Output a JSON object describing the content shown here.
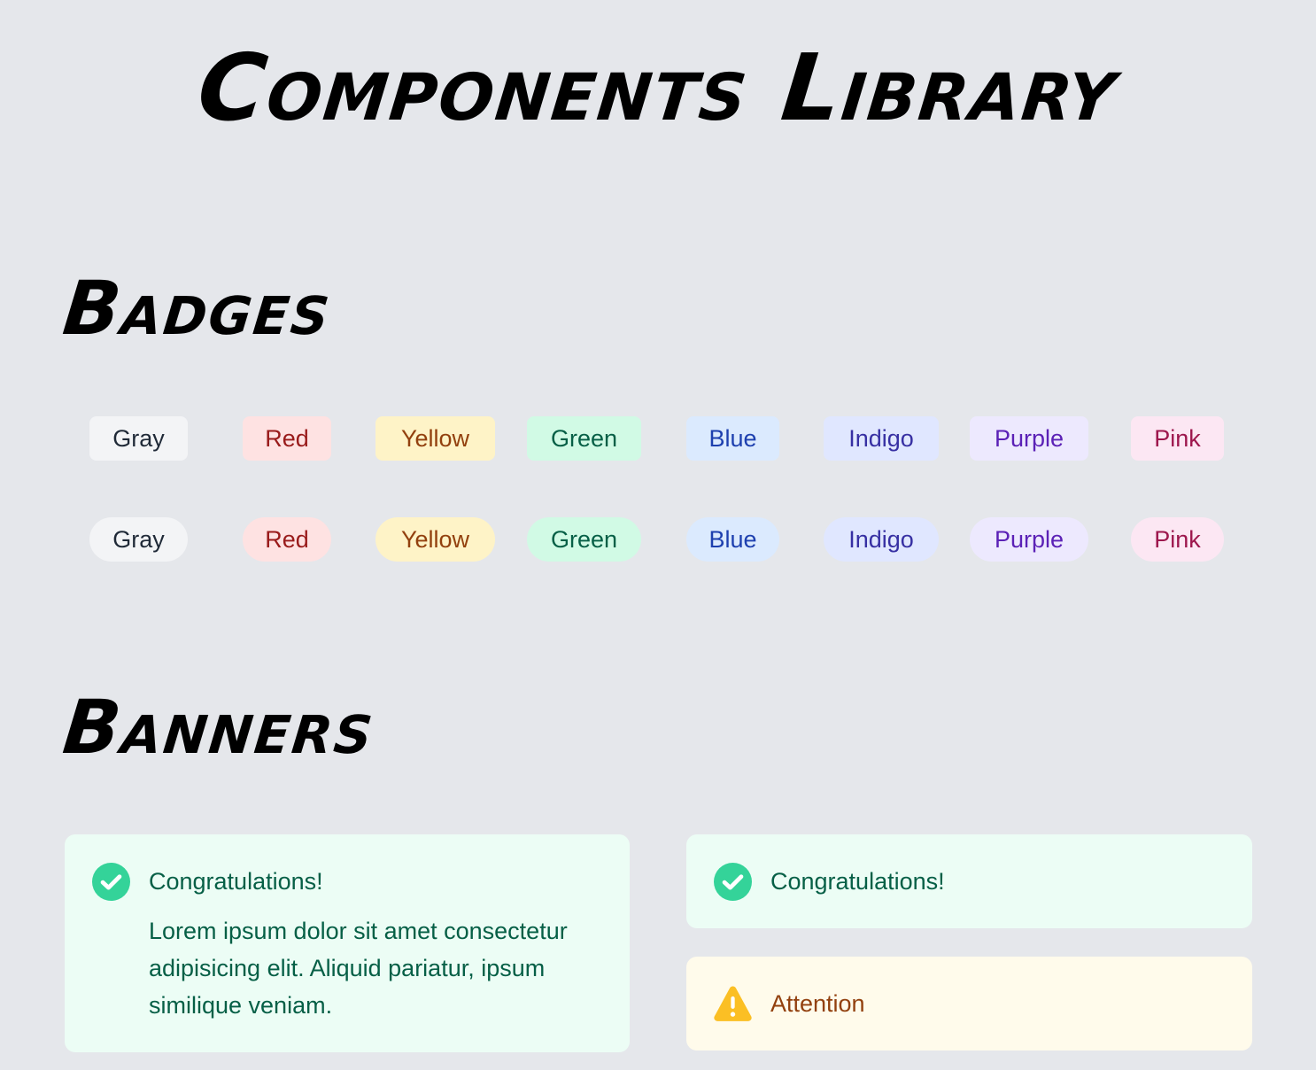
{
  "title": "Components Library",
  "sections": {
    "badges": {
      "title": "Badges"
    },
    "banners": {
      "title": "Banners"
    }
  },
  "badges": [
    {
      "label": "Gray",
      "bg": "#f3f4f6",
      "fg": "#1f2937"
    },
    {
      "label": "Red",
      "bg": "#fee2e2",
      "fg": "#991b1b"
    },
    {
      "label": "Yellow",
      "bg": "#fef3c7",
      "fg": "#92400e"
    },
    {
      "label": "Green",
      "bg": "#d1fae5",
      "fg": "#065f46"
    },
    {
      "label": "Blue",
      "bg": "#dbeafe",
      "fg": "#1e40af"
    },
    {
      "label": "Indigo",
      "bg": "#e0e7ff",
      "fg": "#3730a3"
    },
    {
      "label": "Purple",
      "bg": "#ede9fe",
      "fg": "#5b21b6"
    },
    {
      "label": "Pink",
      "bg": "#fce7f3",
      "fg": "#9d174d"
    }
  ],
  "banners": {
    "success_detailed": {
      "title": "Congratulations!",
      "body": "Lorem ipsum dolor sit amet consectetur adipisicing elit. Aliquid pariatur, ipsum similique veniam.",
      "icon": "check-circle-icon",
      "bg": "#ecfdf5",
      "fg": "#065f46",
      "icon_color": "#34d399"
    },
    "success_simple": {
      "title": "Congratulations!",
      "icon": "check-circle-icon",
      "bg": "#ecfdf5",
      "fg": "#065f46",
      "icon_color": "#34d399"
    },
    "warning": {
      "title": "Attention",
      "icon": "warning-triangle-icon",
      "bg": "#fffbeb",
      "fg": "#92400e",
      "icon_color": "#fbbf24"
    }
  }
}
